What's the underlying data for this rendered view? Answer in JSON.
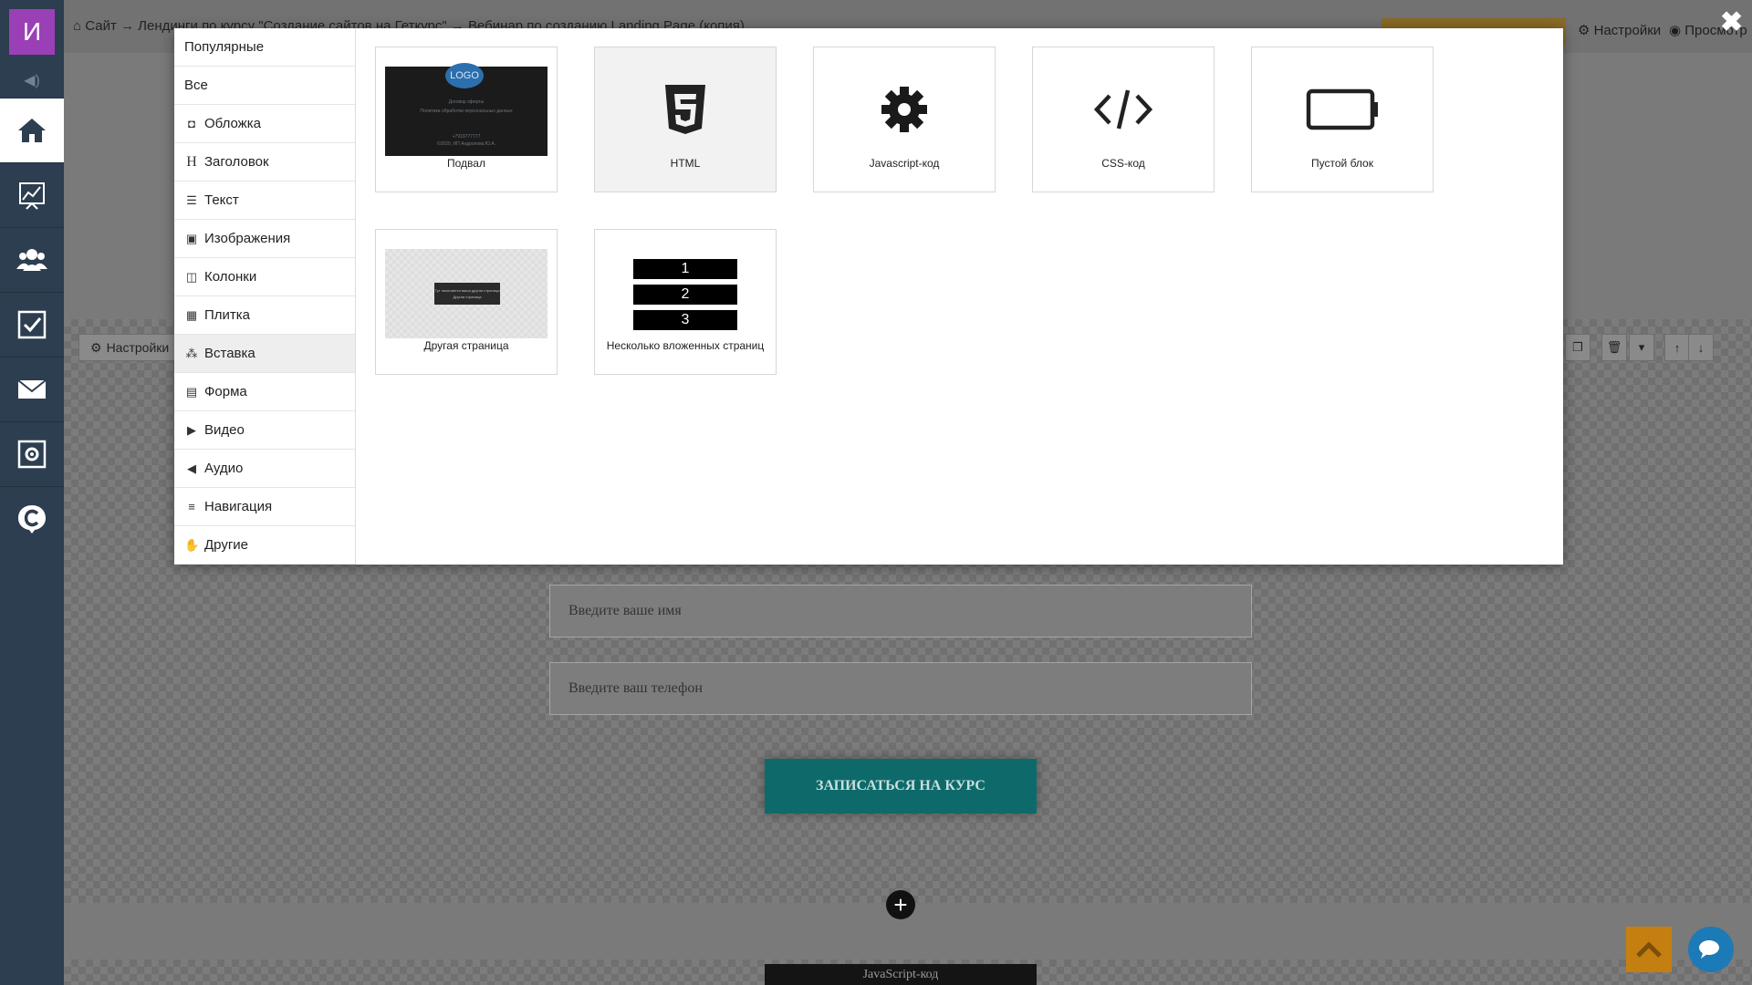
{
  "colors": {
    "accent_purple": "#9b3fb7",
    "sidebar": "#2c3e50",
    "cta": "#0e6a6a",
    "orange": "#c47f10",
    "chat": "#1c7ab7"
  },
  "sidebar": {
    "avatar_letter": "И",
    "items": [
      {
        "icon": "home-icon"
      },
      {
        "icon": "chart-icon"
      },
      {
        "icon": "users-icon"
      },
      {
        "icon": "checkbox-icon"
      },
      {
        "icon": "mail-icon"
      },
      {
        "icon": "settings-box-icon"
      },
      {
        "icon": "chat-c-icon"
      }
    ]
  },
  "topbar": {
    "breadcrumb": "Сайт → Лендинги по курсу \"Создание сайтов на Геткурс\" → Вебинар по созданию Landing Page (копия)",
    "settings": "Настройки",
    "preview": "Просмотр"
  },
  "block_toolbar": {
    "settings": "Настройки"
  },
  "modal": {
    "categories": [
      {
        "label": "Популярные",
        "icon": ""
      },
      {
        "label": "Все",
        "icon": ""
      },
      {
        "label": "Обложка",
        "icon": "camera-icon"
      },
      {
        "label": "Заголовок",
        "icon": "header-icon"
      },
      {
        "label": "Текст",
        "icon": "text-lines-icon"
      },
      {
        "label": "Изображения",
        "icon": "image-icon"
      },
      {
        "label": "Колонки",
        "icon": "columns-icon"
      },
      {
        "label": "Плитка",
        "icon": "tiles-icon"
      },
      {
        "label": "Вставка",
        "icon": "cubes-icon"
      },
      {
        "label": "Форма",
        "icon": "form-icon"
      },
      {
        "label": "Видео",
        "icon": "youtube-icon"
      },
      {
        "label": "Аудио",
        "icon": "volume-icon"
      },
      {
        "label": "Навигация",
        "icon": "menu-icon"
      },
      {
        "label": "Другие",
        "icon": "hand-icon"
      }
    ],
    "selected_category": "Вставка",
    "tiles": [
      {
        "label": "Подвал",
        "kind": "footer"
      },
      {
        "label": "HTML",
        "kind": "html"
      },
      {
        "label": "Javascript-код",
        "kind": "js"
      },
      {
        "label": "CSS-код",
        "kind": "css"
      },
      {
        "label": "Пустой блок",
        "kind": "empty"
      },
      {
        "label": "Другая страница",
        "kind": "other-page"
      },
      {
        "label": "Несколько вложенных страниц",
        "kind": "nested"
      }
    ],
    "footer_preview": {
      "logo": "LOGO",
      "lines": [
        "Договор оферты",
        "Политика обработки персональных данных",
        "+7919777777",
        "©2020, ИП Андропова Ю.А."
      ]
    },
    "other_page_preview": {
      "line1": "Тут начинается ваша другая страница",
      "line2": "Другая страница"
    },
    "nested_preview": [
      "1",
      "2",
      "3"
    ]
  },
  "form": {
    "name_placeholder": "Введите ваше имя",
    "phone_placeholder": "Введите ваш телефон",
    "cta": "ЗАПИСАТЬСЯ НА КУРС"
  },
  "js_block_label": "JavaScript-код"
}
